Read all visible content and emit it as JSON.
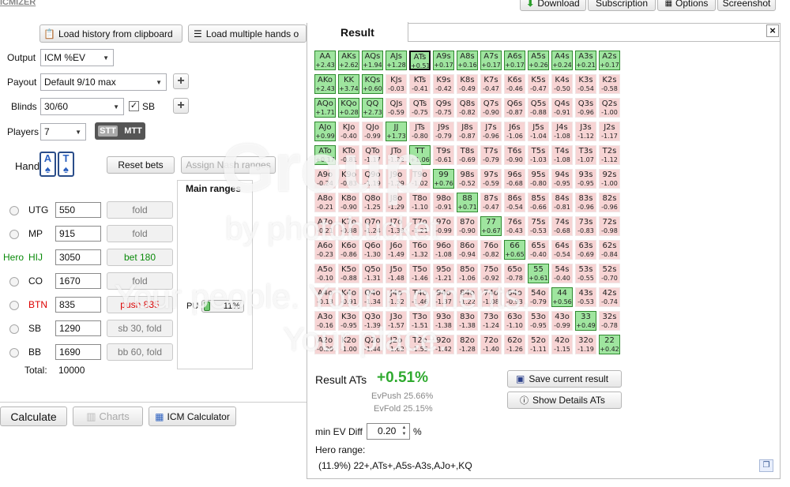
{
  "app": {
    "title": "ICMIZER"
  },
  "toolbar": {
    "download": "Download",
    "subscription": "Subscription",
    "options": "Options",
    "screenshot": "Screenshot"
  },
  "left": {
    "load_history": "Load history from clipboard",
    "load_multiple": "Load multiple hands o",
    "output_label": "Output",
    "output_value": "ICM %EV",
    "payout_label": "Payout",
    "payout_value": "Default 9/10 max",
    "blinds_label": "Blinds",
    "blinds_value": "30/60",
    "sb_label": "SB",
    "players_label": "Players",
    "players_value": "7",
    "stt": "STT",
    "mtt": "MTT",
    "hand_label": "Hand",
    "card1": "A",
    "card2": "T",
    "reset_bets": "Reset bets",
    "assign_nash": "Assign Nash ranges",
    "main_ranges": "Main ranges",
    "pu_label": "PU",
    "pu_pct": "11%",
    "hero_label": "Hero",
    "players": [
      {
        "pos": "UTG",
        "stack": "550",
        "action": "fold"
      },
      {
        "pos": "MP",
        "stack": "915",
        "action": "fold"
      },
      {
        "pos": "HIJ",
        "stack": "3050",
        "action": "bet 180"
      },
      {
        "pos": "CO",
        "stack": "1670",
        "action": "fold"
      },
      {
        "pos": "BTN",
        "stack": "835",
        "action": "push 835"
      },
      {
        "pos": "SB",
        "stack": "1290",
        "action": "sb 30, fold"
      },
      {
        "pos": "BB",
        "stack": "1690",
        "action": "bb 60, fold"
      }
    ],
    "total_label": "Total:",
    "total_value": "10000",
    "calculate": "Calculate",
    "charts": "Charts",
    "icm_calculator": "ICM Calculator"
  },
  "result": {
    "tab": "Result",
    "close": "×",
    "result_label": "Result ATs",
    "result_value": "+0.51%",
    "evpush": "EvPush 25.66%",
    "evfold": "EvFold 25.15%",
    "save": "Save current result",
    "details": "Show Details ATs",
    "min_ev_label": "min EV Diff",
    "min_ev_value": "0.20",
    "pct": "%",
    "hero_range_label": "Hero range:",
    "hero_range": "(11.9%) 22+,ATs+,A5s-A3s,AJo+,KQ"
  },
  "watermark": {
    "line1": "Group",
    "line2": "by photobucket",
    "line3": "Your people. Your moments.",
    "line4": "Your place."
  },
  "grid": [
    [
      [
        "AA",
        "+2.43"
      ],
      [
        "AKs",
        "+2.62"
      ],
      [
        "AQs",
        "+1.94"
      ],
      [
        "AJs",
        "+1.28"
      ],
      [
        "ATs",
        "+0.51"
      ],
      [
        "A9s",
        "+0.17"
      ],
      [
        "A8s",
        "+0.16"
      ],
      [
        "A7s",
        "+0.17"
      ],
      [
        "A6s",
        "+0.17"
      ],
      [
        "A5s",
        "+0.26"
      ],
      [
        "A4s",
        "+0.24"
      ],
      [
        "A3s",
        "+0.21"
      ],
      [
        "A2s",
        "+0.17"
      ]
    ],
    [
      [
        "AKo",
        "+2.43"
      ],
      [
        "KK",
        "+3.74"
      ],
      [
        "KQs",
        "+0.60"
      ],
      [
        "KJs",
        "-0.03"
      ],
      [
        "KTs",
        "-0.41"
      ],
      [
        "K9s",
        "-0.42"
      ],
      [
        "K8s",
        "-0.49"
      ],
      [
        "K7s",
        "-0.47"
      ],
      [
        "K6s",
        "-0.46"
      ],
      [
        "K5s",
        "-0.47"
      ],
      [
        "K4s",
        "-0.50"
      ],
      [
        "K3s",
        "-0.54"
      ],
      [
        "K2s",
        "-0.58"
      ]
    ],
    [
      [
        "AQo",
        "+1.71"
      ],
      [
        "KQo",
        "+0.28"
      ],
      [
        "QQ",
        "+2.73"
      ],
      [
        "QJs",
        "-0.59"
      ],
      [
        "QTs",
        "-0.75"
      ],
      [
        "Q9s",
        "-0.75"
      ],
      [
        "Q8s",
        "-0.82"
      ],
      [
        "Q7s",
        "-0.90"
      ],
      [
        "Q6s",
        "-0.87"
      ],
      [
        "Q5s",
        "-0.88"
      ],
      [
        "Q4s",
        "-0.91"
      ],
      [
        "Q3s",
        "-0.96"
      ],
      [
        "Q2s",
        "-1.00"
      ]
    ],
    [
      [
        "AJo",
        "+0.99"
      ],
      [
        "KJo",
        "-0.40"
      ],
      [
        "QJo",
        "-0.99"
      ],
      [
        "JJ",
        "+1.73"
      ],
      [
        "JTs",
        "-0.80"
      ],
      [
        "J9s",
        "-0.79"
      ],
      [
        "J8s",
        "-0.87"
      ],
      [
        "J7s",
        "-0.96"
      ],
      [
        "J6s",
        "-1.06"
      ],
      [
        "J5s",
        "-1.04"
      ],
      [
        "J4s",
        "-1.08"
      ],
      [
        "J3s",
        "-1.12"
      ],
      [
        "J2s",
        "-1.17"
      ]
    ],
    [
      [
        "ATo",
        "+0.17"
      ],
      [
        "KTo",
        "-0.81"
      ],
      [
        "QTo",
        "-1.17"
      ],
      [
        "JTo",
        "-1.22"
      ],
      [
        "TT",
        "+1.06"
      ],
      [
        "T9s",
        "-0.61"
      ],
      [
        "T8s",
        "-0.69"
      ],
      [
        "T7s",
        "-0.79"
      ],
      [
        "T6s",
        "-0.90"
      ],
      [
        "T5s",
        "-1.03"
      ],
      [
        "T4s",
        "-1.08"
      ],
      [
        "T3s",
        "-1.07"
      ],
      [
        "T2s",
        "-1.12"
      ]
    ],
    [
      [
        "A9o",
        "-0.24"
      ],
      [
        "K9o",
        "-0.83"
      ],
      [
        "Q9o",
        "-1.19"
      ],
      [
        "J9o",
        "-1.29"
      ],
      [
        "T9o",
        "-1.02"
      ],
      [
        "99",
        "+0.76"
      ],
      [
        "98s",
        "-0.52"
      ],
      [
        "97s",
        "-0.59"
      ],
      [
        "96s",
        "-0.68"
      ],
      [
        "95s",
        "-0.80"
      ],
      [
        "94s",
        "-0.95"
      ],
      [
        "93s",
        "-0.95"
      ],
      [
        "92s",
        "-1.00"
      ]
    ],
    [
      [
        "A8o",
        "-0.21"
      ],
      [
        "K8o",
        "-0.90"
      ],
      [
        "Q8o",
        "-1.25"
      ],
      [
        "J8o",
        "-1.29"
      ],
      [
        "T8o",
        "-1.10"
      ],
      [
        "98o",
        "-0.91"
      ],
      [
        "88",
        "+0.71"
      ],
      [
        "87s",
        "-0.47"
      ],
      [
        "86s",
        "-0.54"
      ],
      [
        "85s",
        "-0.66"
      ],
      [
        "84s",
        "-0.81"
      ],
      [
        "83s",
        "-0.96"
      ],
      [
        "82s",
        "-0.96"
      ]
    ],
    [
      [
        "A7o",
        "-0.21"
      ],
      [
        "K7o",
        "-0.88"
      ],
      [
        "Q7o",
        "-1.24"
      ],
      [
        "J7o",
        "-1.39"
      ],
      [
        "T7o",
        "-1.21"
      ],
      [
        "97o",
        "-0.99"
      ],
      [
        "87o",
        "-0.90"
      ],
      [
        "77",
        "+0.67"
      ],
      [
        "76s",
        "-0.43"
      ],
      [
        "75s",
        "-0.53"
      ],
      [
        "74s",
        "-0.68"
      ],
      [
        "73s",
        "-0.83"
      ],
      [
        "72s",
        "-0.98"
      ]
    ],
    [
      [
        "A6o",
        "-0.23"
      ],
      [
        "K6o",
        "-0.86"
      ],
      [
        "Q6o",
        "-1.30"
      ],
      [
        "J6o",
        "-1.49"
      ],
      [
        "T6o",
        "-1.32"
      ],
      [
        "96o",
        "-1.08"
      ],
      [
        "86o",
        "-0.94"
      ],
      [
        "76o",
        "-0.82"
      ],
      [
        "66",
        "+0.65"
      ],
      [
        "65s",
        "-0.40"
      ],
      [
        "64s",
        "-0.54"
      ],
      [
        "63s",
        "-0.69"
      ],
      [
        "62s",
        "-0.84"
      ]
    ],
    [
      [
        "A5o",
        "-0.10"
      ],
      [
        "K5o",
        "-0.88"
      ],
      [
        "Q5o",
        "-1.31"
      ],
      [
        "J5o",
        "-1.48"
      ],
      [
        "T5o",
        "-1.46"
      ],
      [
        "95o",
        "-1.21"
      ],
      [
        "85o",
        "-1.06"
      ],
      [
        "75o",
        "-0.92"
      ],
      [
        "65o",
        "-0.78"
      ],
      [
        "55",
        "+0.61"
      ],
      [
        "54s",
        "-0.40"
      ],
      [
        "53s",
        "-0.55"
      ],
      [
        "52s",
        "-0.70"
      ]
    ],
    [
      [
        "A4o",
        "-0.13"
      ],
      [
        "K4o",
        "-0.91"
      ],
      [
        "Q4o",
        "-1.34"
      ],
      [
        "J4o",
        "-1.52"
      ],
      [
        "T4o",
        "-1.46"
      ],
      [
        "94o",
        "-1.37"
      ],
      [
        "84o",
        "-1.22"
      ],
      [
        "74o",
        "-1.08"
      ],
      [
        "64o",
        "-0.93"
      ],
      [
        "54o",
        "-0.79"
      ],
      [
        "44",
        "+0.56"
      ],
      [
        "43s",
        "-0.53"
      ],
      [
        "42s",
        "-0.74"
      ]
    ],
    [
      [
        "A3o",
        "-0.16"
      ],
      [
        "K3o",
        "-0.95"
      ],
      [
        "Q3o",
        "-1.39"
      ],
      [
        "J3o",
        "-1.57"
      ],
      [
        "T3o",
        "-1.51"
      ],
      [
        "93o",
        "-1.38"
      ],
      [
        "83o",
        "-1.38"
      ],
      [
        "73o",
        "-1.24"
      ],
      [
        "63o",
        "-1.10"
      ],
      [
        "53o",
        "-0.95"
      ],
      [
        "43o",
        "-0.99"
      ],
      [
        "33",
        "+0.49"
      ],
      [
        "32s",
        "-0.78"
      ]
    ],
    [
      [
        "A2o",
        "-0.20"
      ],
      [
        "K2o",
        "-1.00"
      ],
      [
        "Q2o",
        "-1.44"
      ],
      [
        "J2o",
        "-1.62"
      ],
      [
        "T2o",
        "-1.55"
      ],
      [
        "92o",
        "-1.42"
      ],
      [
        "82o",
        "-1.28"
      ],
      [
        "72o",
        "-1.40"
      ],
      [
        "62o",
        "-1.26"
      ],
      [
        "52o",
        "-1.11"
      ],
      [
        "42o",
        "-1.15"
      ],
      [
        "32o",
        "-1.19"
      ],
      [
        "22",
        "+0.42"
      ]
    ]
  ],
  "colors": {
    "push": "#9fe59f",
    "fold": "#f7d4d4",
    "positive_text": "#2faa2f",
    "btn_text": "#dd0000",
    "hero_text": "#0a8a0a"
  }
}
